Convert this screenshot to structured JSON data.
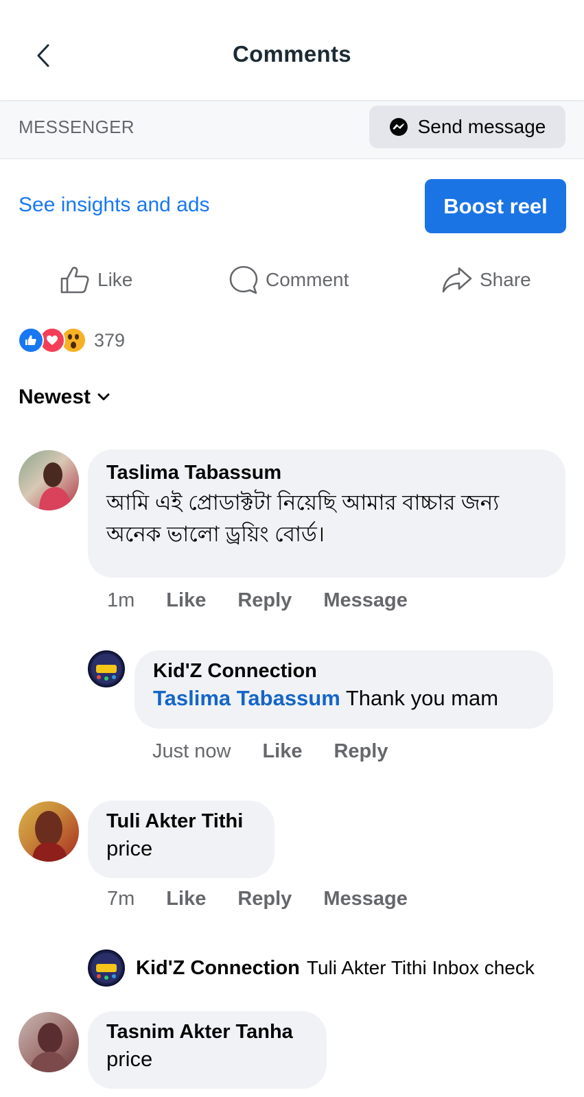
{
  "header": {
    "title": "Comments",
    "back_icon": "chevron-left-icon"
  },
  "messenger": {
    "label": "MESSENGER",
    "send_label": "Send message"
  },
  "insights": {
    "link": "See insights and ads",
    "boost": "Boost reel"
  },
  "actions": {
    "like": "Like",
    "comment": "Comment",
    "share": "Share"
  },
  "reactions": {
    "count": "379",
    "types": [
      "like",
      "love",
      "wow"
    ]
  },
  "sort": {
    "label": "Newest"
  },
  "comments": [
    {
      "author": "Taslima Tabassum",
      "text": "আমি এই প্রোডাক্টটা নিয়েছি আমার বাচ্চার জন্য অনেক ভালো ড্রয়িং বোর্ড।",
      "time": "1m",
      "like": "Like",
      "reply": "Reply",
      "message": "Message",
      "reply_item": {
        "author": "Kid'Z Connection",
        "tag": "Taslima Tabassum",
        "text": "Thank you mam",
        "time": "Just now",
        "like": "Like",
        "reply": "Reply"
      }
    },
    {
      "author": "Tuli Akter Tithi",
      "text": "price",
      "time": "7m",
      "like": "Like",
      "reply": "Reply",
      "message": "Message",
      "collapsed_reply": {
        "author": "Kid'Z Connection",
        "text": "Tuli Akter Tithi Inbox check"
      }
    },
    {
      "author": "Tasnim Akter Tanha",
      "text": "price"
    }
  ],
  "colors": {
    "accent": "#1b74e4",
    "link": "#1877f2",
    "bubble": "#f0f2f5",
    "muted": "#65676b"
  }
}
